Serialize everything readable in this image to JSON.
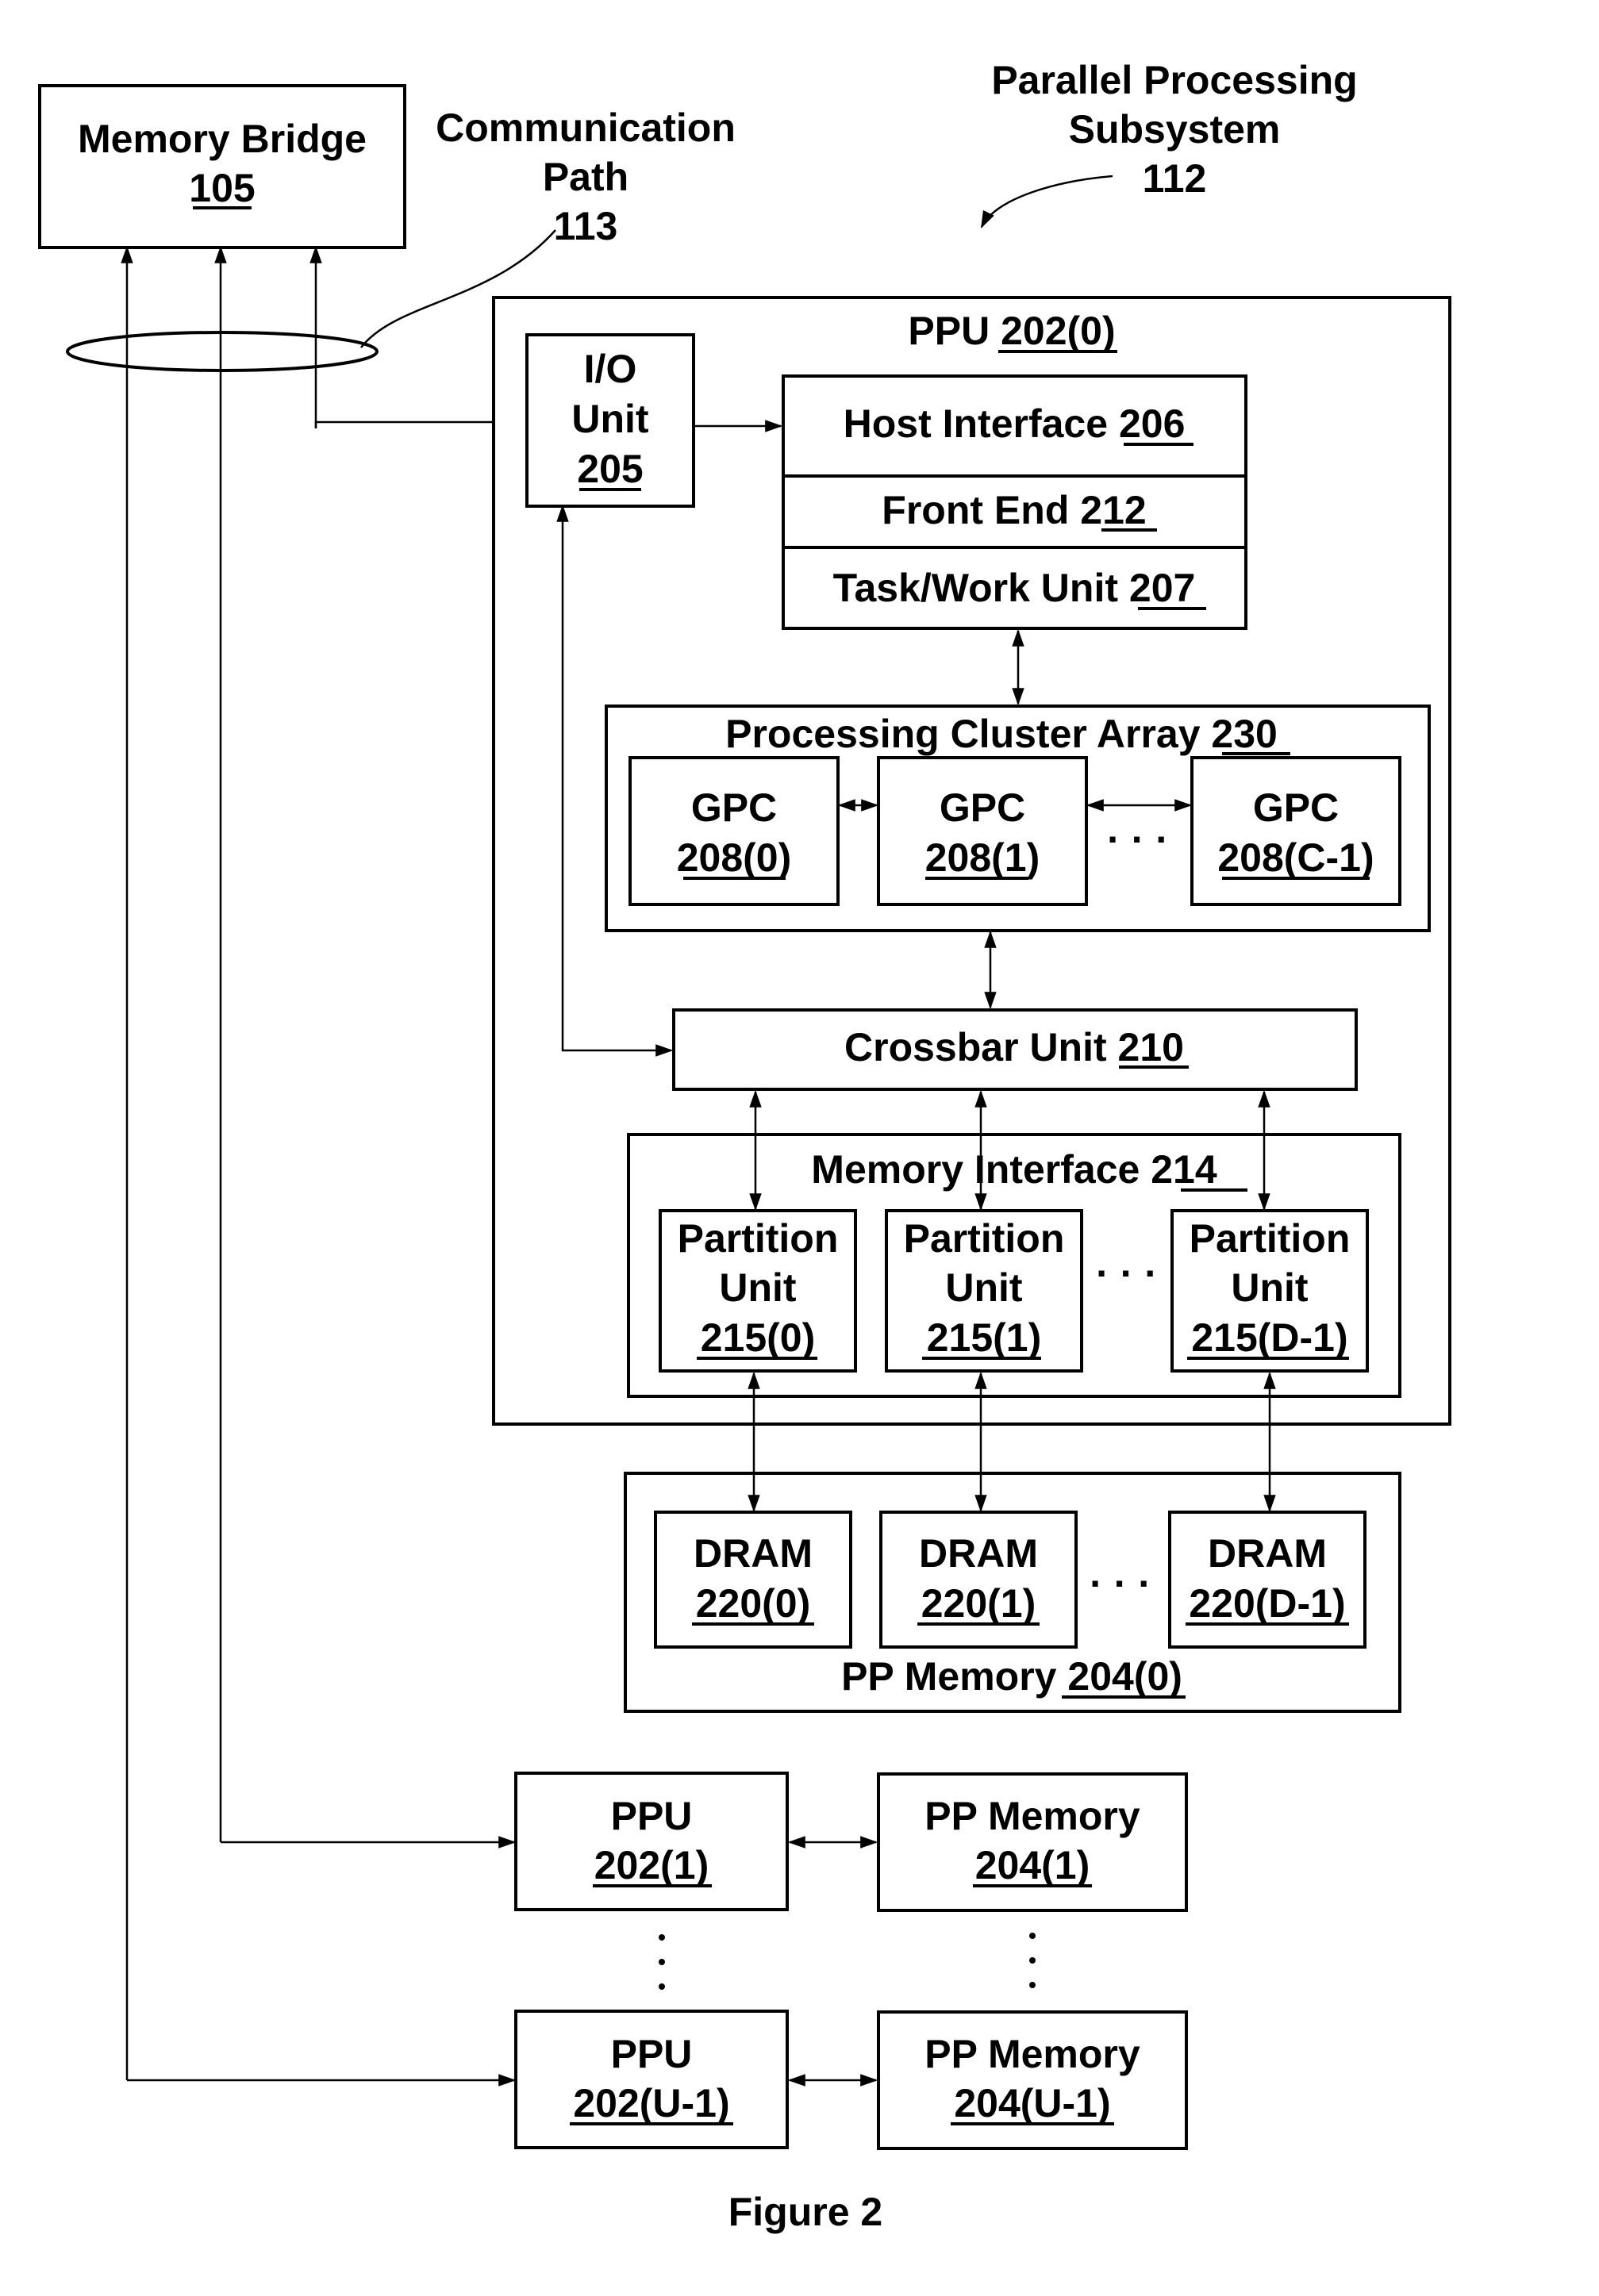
{
  "figure": {
    "caption": "Figure 2",
    "colors": {
      "stroke": "#000000",
      "background": "#ffffff"
    }
  },
  "labels": {
    "memory_bridge": {
      "name": "Memory Bridge",
      "ref": "105"
    },
    "communication_path": {
      "line1": "Communication",
      "line2": "Path",
      "ref": "113"
    },
    "subsystem": {
      "line1": "Parallel Processing",
      "line2": "Subsystem",
      "ref": "112"
    },
    "ppu0": {
      "name": "PPU",
      "ref": "202(0)"
    },
    "io_unit": {
      "line1": "I/O",
      "line2": "Unit",
      "ref": "205"
    },
    "host_interface": {
      "name": "Host Interface",
      "ref": "206"
    },
    "front_end": {
      "name": "Front End",
      "ref": "212"
    },
    "task_work_unit": {
      "name": "Task/Work Unit",
      "ref": "207"
    },
    "pca": {
      "name": "Processing Cluster Array",
      "ref": "230"
    },
    "gpcs": [
      {
        "name": "GPC",
        "ref": "208(0)"
      },
      {
        "name": "GPC",
        "ref": "208(1)"
      },
      {
        "name": "GPC",
        "ref": "208(C-1)"
      }
    ],
    "crossbar": {
      "name": "Crossbar Unit",
      "ref": "210"
    },
    "memory_interface": {
      "name": "Memory Interface",
      "ref": "214"
    },
    "partitions": [
      {
        "line1": "Partition",
        "line2": "Unit",
        "ref": "215(0)"
      },
      {
        "line1": "Partition",
        "line2": "Unit",
        "ref": "215(1)"
      },
      {
        "line1": "Partition",
        "line2": "Unit",
        "ref": "215(D-1)"
      }
    ],
    "pp_memory0": {
      "name": "PP Memory",
      "ref": "204(0)"
    },
    "drams": [
      {
        "name": "DRAM",
        "ref": "220(0)"
      },
      {
        "name": "DRAM",
        "ref": "220(1)"
      },
      {
        "name": "DRAM",
        "ref": "220(D-1)"
      }
    ],
    "ppu1": {
      "name": "PPU",
      "ref": "202(1)"
    },
    "ppmem1": {
      "name": "PP Memory",
      "ref": "204(1)"
    },
    "ppuU": {
      "name": "PPU",
      "ref": "202(U-1)"
    },
    "ppmemU": {
      "name": "PP Memory",
      "ref": "204(U-1)"
    },
    "ellipsis": "· · ·"
  }
}
